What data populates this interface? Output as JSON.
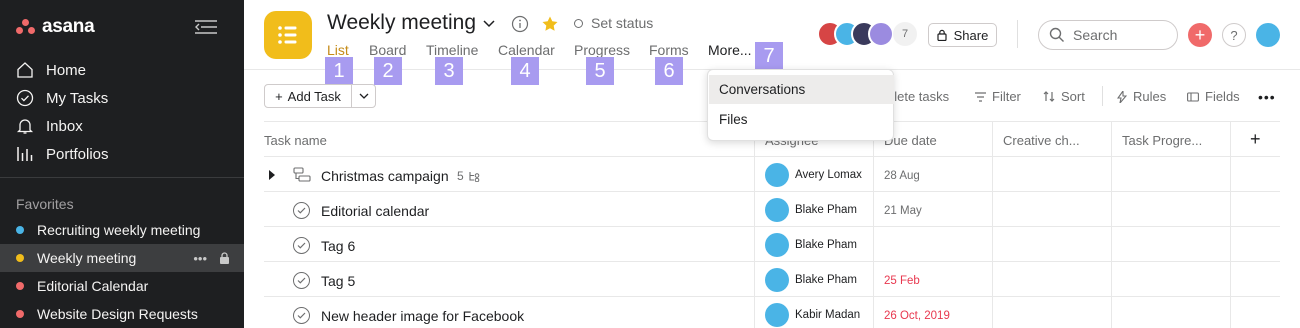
{
  "sidebar": {
    "logo": "asana",
    "nav": [
      {
        "label": "Home",
        "icon": "home-icon"
      },
      {
        "label": "My Tasks",
        "icon": "check-circle-icon"
      },
      {
        "label": "Inbox",
        "icon": "bell-icon"
      },
      {
        "label": "Portfolios",
        "icon": "bar-chart-icon"
      }
    ],
    "favorites_title": "Favorites",
    "favorites": [
      {
        "label": "Recruiting weekly meeting",
        "color": "#4ab4e6"
      },
      {
        "label": "Weekly meeting",
        "color": "#f1bd1b"
      },
      {
        "label": "Editorial Calendar",
        "color": "#f06a6a"
      },
      {
        "label": "Website Design Requests",
        "color": "#f06a6a"
      }
    ]
  },
  "header": {
    "title": "Weekly meeting",
    "set_status": "Set status",
    "tabs": [
      "List",
      "Board",
      "Timeline",
      "Calendar",
      "Progress",
      "Forms",
      "More..."
    ],
    "badges": [
      "1",
      "2",
      "3",
      "4",
      "5",
      "6",
      "7"
    ],
    "member_count": "7",
    "share_label": "Share",
    "search_placeholder": "Search",
    "help": "?"
  },
  "toolbar": {
    "add_task": "Add Task",
    "complete_tasks": "plete tasks",
    "filter": "Filter",
    "sort": "Sort",
    "rules": "Rules",
    "fields": "Fields"
  },
  "table": {
    "columns": [
      "Task name",
      "Assignee",
      "Due date",
      "Creative ch...",
      "Task Progre..."
    ],
    "rows": [
      {
        "name": "Christmas campaign",
        "subtasks": "5",
        "assignee": "Avery Lomax",
        "due": "28 Aug",
        "overdue": false
      },
      {
        "name": "Editorial calendar",
        "subtasks": "",
        "assignee": "Blake Pham",
        "due": "21 May",
        "overdue": false
      },
      {
        "name": "Tag 6",
        "subtasks": "",
        "assignee": "Blake Pham",
        "due": "",
        "overdue": false
      },
      {
        "name": "Tag 5",
        "subtasks": "",
        "assignee": "Blake Pham",
        "due": "25 Feb",
        "overdue": true
      },
      {
        "name": "New header image for Facebook",
        "subtasks": "",
        "assignee": "Kabir Madan",
        "due": "26 Oct, 2019",
        "overdue": true
      }
    ]
  },
  "more_menu": {
    "items": [
      "Conversations",
      "Files"
    ]
  },
  "colors": {
    "sidebar_bg": "#1e1f21",
    "accent_tab": "#c58b18",
    "badge": "#a89bf0",
    "project_icon": "#f1bd1b",
    "overdue": "#e8384f"
  }
}
